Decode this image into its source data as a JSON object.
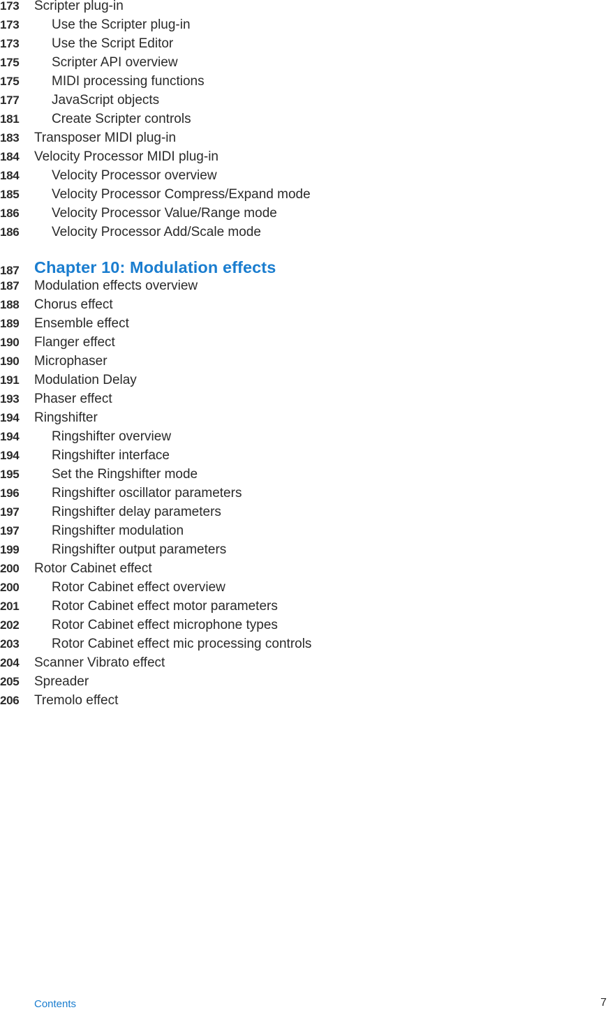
{
  "toc": {
    "before_chapter": [
      {
        "page": "173",
        "title": "Scripter plug-in",
        "level": 1
      },
      {
        "page": "173",
        "title": "Use the Scripter plug-in",
        "level": 2
      },
      {
        "page": "173",
        "title": "Use the Script Editor",
        "level": 2
      },
      {
        "page": "175",
        "title": "Scripter API overview",
        "level": 2
      },
      {
        "page": "175",
        "title": "MIDI processing functions",
        "level": 2
      },
      {
        "page": "177",
        "title": "JavaScript objects",
        "level": 2
      },
      {
        "page": "181",
        "title": "Create Scripter controls",
        "level": 2
      },
      {
        "page": "183",
        "title": "Transposer MIDI plug-in",
        "level": 1
      },
      {
        "page": "184",
        "title": "Velocity Processor MIDI plug-in",
        "level": 1
      },
      {
        "page": "184",
        "title": "Velocity Processor overview",
        "level": 2
      },
      {
        "page": "185",
        "title": "Velocity Processor Compress/Expand mode",
        "level": 2
      },
      {
        "page": "186",
        "title": "Velocity Processor Value/Range mode",
        "level": 2
      },
      {
        "page": "186",
        "title": "Velocity Processor Add/Scale mode",
        "level": 2
      }
    ],
    "chapter": {
      "page": "187",
      "title": "Chapter 10: Modulation effects"
    },
    "after_chapter": [
      {
        "page": "187",
        "title": "Modulation effects overview",
        "level": 1
      },
      {
        "page": "188",
        "title": "Chorus effect",
        "level": 1
      },
      {
        "page": "189",
        "title": "Ensemble effect",
        "level": 1
      },
      {
        "page": "190",
        "title": "Flanger effect",
        "level": 1
      },
      {
        "page": "190",
        "title": "Microphaser",
        "level": 1
      },
      {
        "page": "191",
        "title": "Modulation Delay",
        "level": 1
      },
      {
        "page": "193",
        "title": "Phaser effect",
        "level": 1
      },
      {
        "page": "194",
        "title": "Ringshifter",
        "level": 1
      },
      {
        "page": "194",
        "title": "Ringshifter overview",
        "level": 2
      },
      {
        "page": "194",
        "title": "Ringshifter interface",
        "level": 2
      },
      {
        "page": "195",
        "title": "Set the Ringshifter mode",
        "level": 2
      },
      {
        "page": "196",
        "title": "Ringshifter oscillator parameters",
        "level": 2
      },
      {
        "page": "197",
        "title": "Ringshifter delay parameters",
        "level": 2
      },
      {
        "page": "197",
        "title": "Ringshifter modulation",
        "level": 2
      },
      {
        "page": "199",
        "title": "Ringshifter output parameters",
        "level": 2
      },
      {
        "page": "200",
        "title": "Rotor Cabinet effect",
        "level": 1
      },
      {
        "page": "200",
        "title": "Rotor Cabinet effect overview",
        "level": 2
      },
      {
        "page": "201",
        "title": "Rotor Cabinet effect motor parameters",
        "level": 2
      },
      {
        "page": "202",
        "title": "Rotor Cabinet effect microphone types",
        "level": 2
      },
      {
        "page": "203",
        "title": "Rotor Cabinet effect mic processing controls",
        "level": 2
      },
      {
        "page": "204",
        "title": "Scanner Vibrato effect",
        "level": 1
      },
      {
        "page": "205",
        "title": "Spreader",
        "level": 1
      },
      {
        "page": "206",
        "title": "Tremolo effect",
        "level": 1
      }
    ]
  },
  "footer": {
    "section_label": "Contents",
    "page_number": "7"
  },
  "colors": {
    "accent": "#1a7dcf",
    "text": "#2a2a2a",
    "background": "#ffffff"
  }
}
